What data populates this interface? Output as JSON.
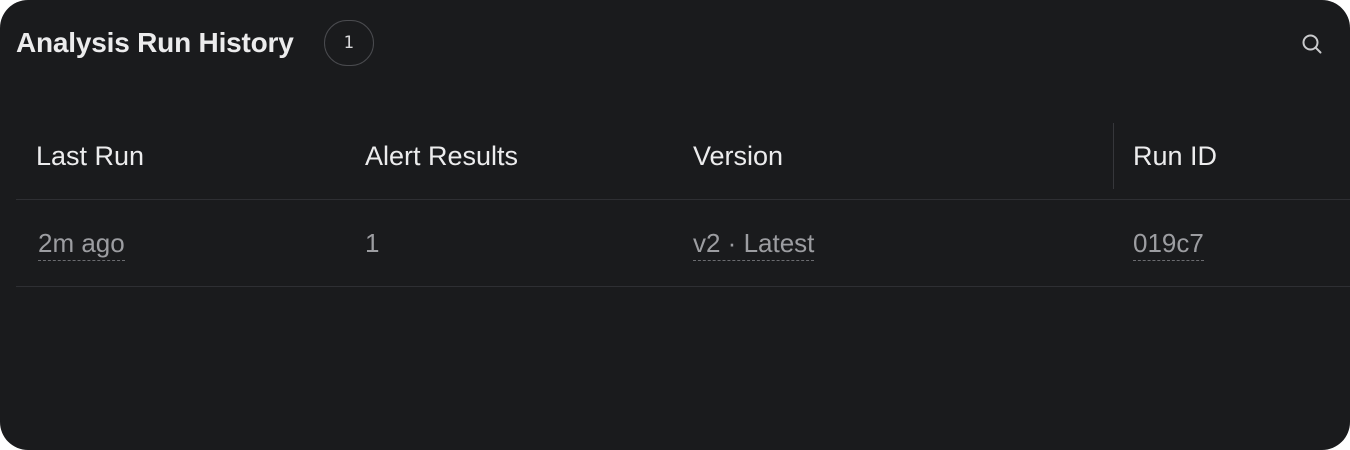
{
  "header": {
    "title": "Analysis Run History",
    "count": "1",
    "search_icon": "search-icon"
  },
  "table": {
    "columns": [
      "Last Run",
      "Alert Results",
      "Version",
      "Run ID"
    ],
    "rows": [
      {
        "last_run": "2m ago",
        "alert_results": "1",
        "version": "v2 · Latest",
        "run_id": "019c7"
      }
    ]
  },
  "colors": {
    "panel_background": "#1a1b1d",
    "border": "#2e2f33",
    "text_primary": "#ececed",
    "text_muted": "#9c9da1"
  }
}
